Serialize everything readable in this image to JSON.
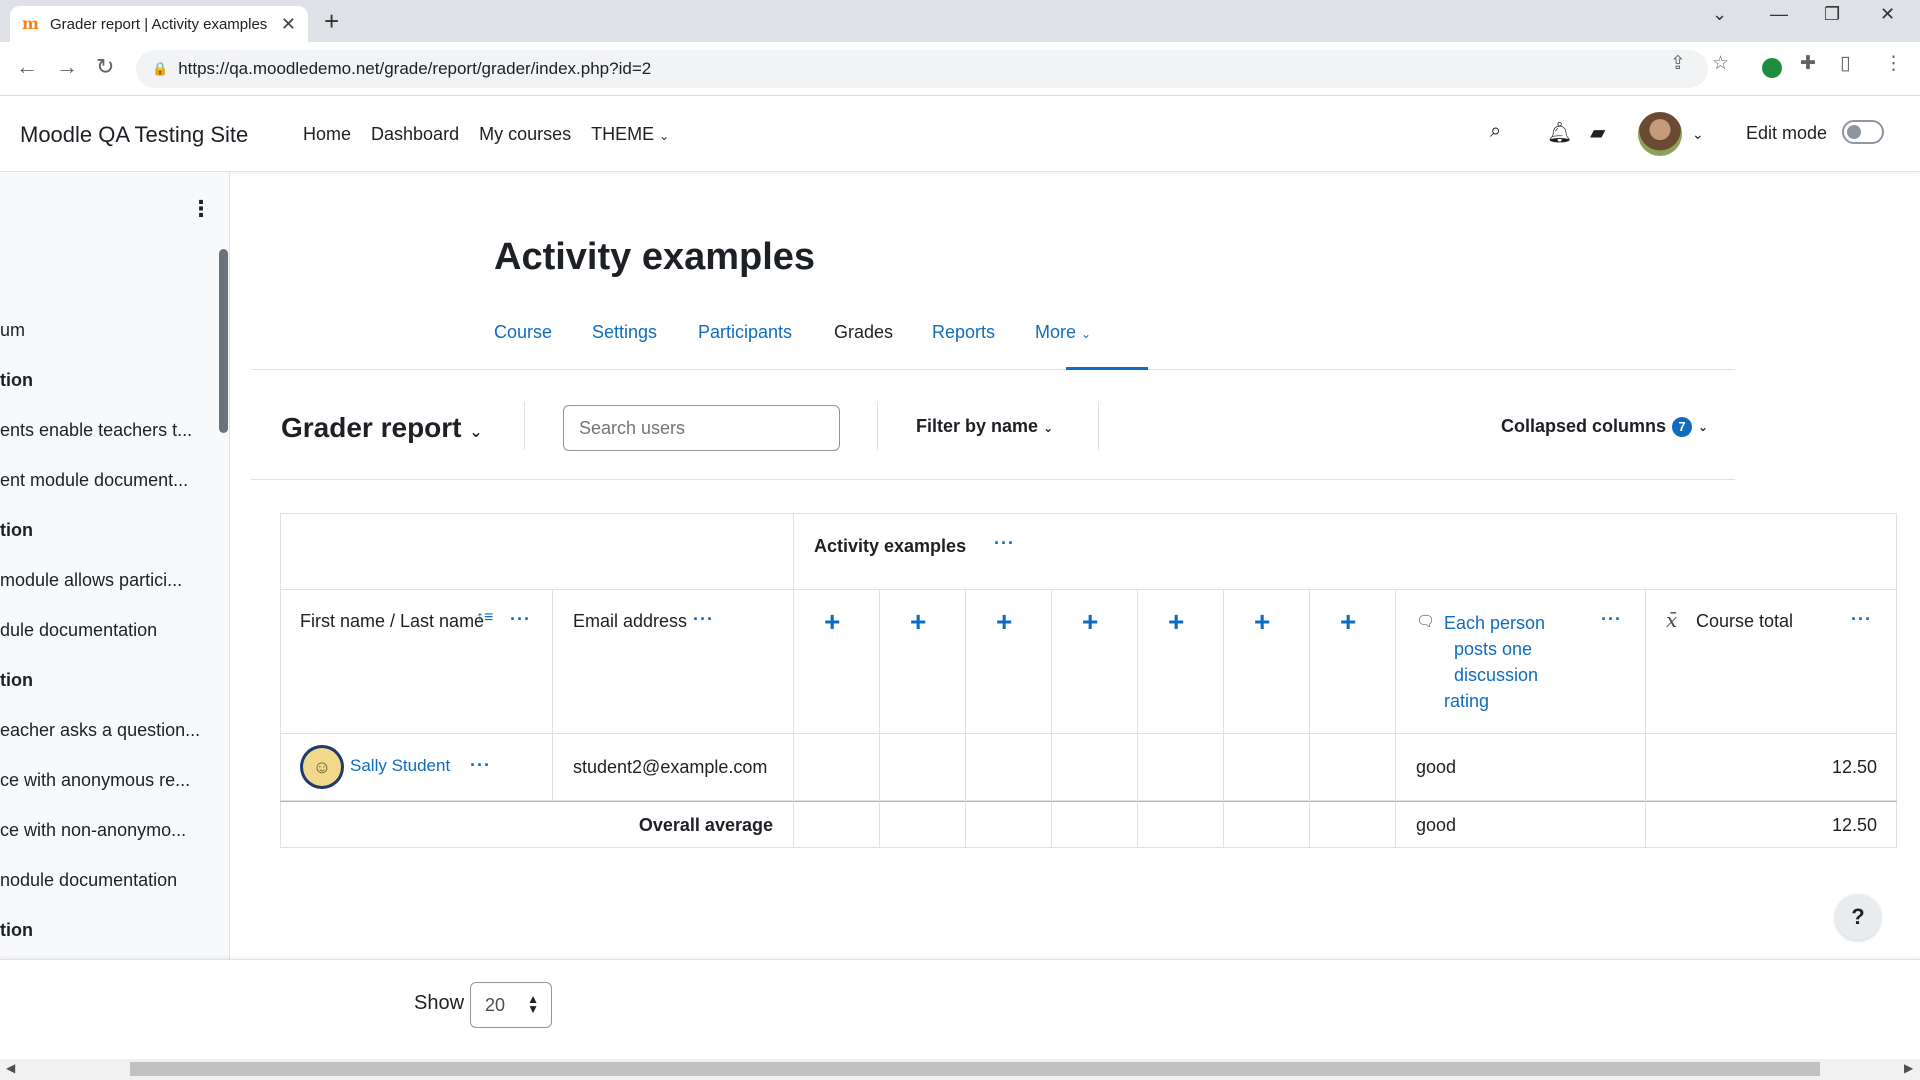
{
  "browser": {
    "tab_title": "Grader report | Activity examples",
    "favicon": "m",
    "url": "https://qa.moodledemo.net/grade/report/grader/index.php?id=2"
  },
  "navbar": {
    "site_name": "Moodle QA Testing Site",
    "items": [
      "Home",
      "Dashboard",
      "My courses",
      "THEME"
    ],
    "edit_mode_label": "Edit mode"
  },
  "drawer": {
    "items": [
      {
        "text": "um",
        "section": false
      },
      {
        "text": "tion",
        "section": true
      },
      {
        "text": "ents enable teachers t...",
        "section": false
      },
      {
        "text": "ent module document...",
        "section": false
      },
      {
        "text": "tion",
        "section": true
      },
      {
        "text": " module allows partici...",
        "section": false
      },
      {
        "text": "dule documentation",
        "section": false
      },
      {
        "text": "tion",
        "section": true
      },
      {
        "text": "eacher asks a question...",
        "section": false
      },
      {
        "text": "ce with anonymous re...",
        "section": false
      },
      {
        "text": "ce with non-anonymo...",
        "section": false
      },
      {
        "text": "nodule documentation",
        "section": false
      },
      {
        "text": "tion",
        "section": true
      }
    ]
  },
  "course": {
    "title": "Activity examples",
    "tabs": [
      "Course",
      "Settings",
      "Participants",
      "Grades",
      "Reports",
      "More"
    ],
    "active_tab": "Grades"
  },
  "tertiary": {
    "report_selector": "Grader report",
    "search_placeholder": "Search users",
    "filter_label": "Filter by name",
    "collapsed_label": "Collapsed columns",
    "collapsed_count": "7"
  },
  "grades": {
    "category_header": "Activity examples",
    "col_name": "First name / Last name",
    "col_email": "Email address",
    "col_item_lines": [
      "Each person",
      "posts one",
      "discussion",
      "rating"
    ],
    "col_total": "Course total",
    "students": [
      {
        "name": "Sally Student",
        "email": "student2@example.com",
        "item_grade": "good",
        "total": "12.50"
      }
    ],
    "average_label": "Overall average",
    "average_item": "good",
    "average_total": "12.50"
  },
  "footer": {
    "show_label": "Show",
    "per_page": "20"
  },
  "help_label": "?"
}
